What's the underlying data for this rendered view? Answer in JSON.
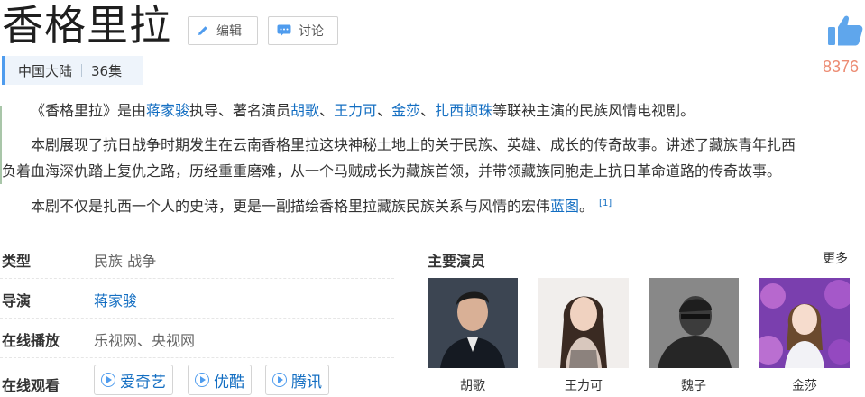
{
  "header": {
    "title": "香格里拉",
    "edit_label": "编辑",
    "discuss_label": "讨论",
    "like_count": "8376"
  },
  "meta": {
    "region": "中国大陆",
    "episodes": "36集"
  },
  "summary": {
    "p1": {
      "open": "《香格里拉》是由",
      "director_link": "蒋家骏",
      "mid": "执导、著名演员",
      "actors": [
        "胡歌",
        "王力可",
        "金莎",
        "扎西顿珠"
      ],
      "sep": "、",
      "close": "等联袂主演的民族风情电视剧。"
    },
    "p2_line1": "本剧展现了抗日战争时期发生在云南香格里拉这块神秘土地上的关于民族、英雄、成长的传奇故事。讲述了藏族青年扎西",
    "p2_line2": "负着血海深仇踏上复仇之路，历经重重磨难，从一个马贼成长为藏族首领，并带领藏族同胞走上抗日革命道路的传奇故事。",
    "p3": {
      "text": "本剧不仅是扎西一个人的史诗，更是一副描绘香格里拉藏族民族关系与风情的宏伟",
      "link": "蓝图",
      "end": "。",
      "cite": "[1]"
    }
  },
  "info": {
    "genre_label": "类型",
    "genre_value": "民族 战争",
    "director_label": "导演",
    "director_value": "蒋家骏",
    "online_play_label": "在线播放",
    "online_play_value": "乐视网、央视网",
    "watch_label": "在线观看",
    "platforms": [
      "爱奇艺",
      "优酷",
      "腾讯"
    ]
  },
  "cast": {
    "title": "主要演员",
    "more": "更多",
    "members": [
      "胡歌",
      "王力可",
      "魏子",
      "金莎"
    ]
  },
  "colors": {
    "link": "#136ec2",
    "accent": "#4f9cee",
    "like": "#ec8b72"
  }
}
